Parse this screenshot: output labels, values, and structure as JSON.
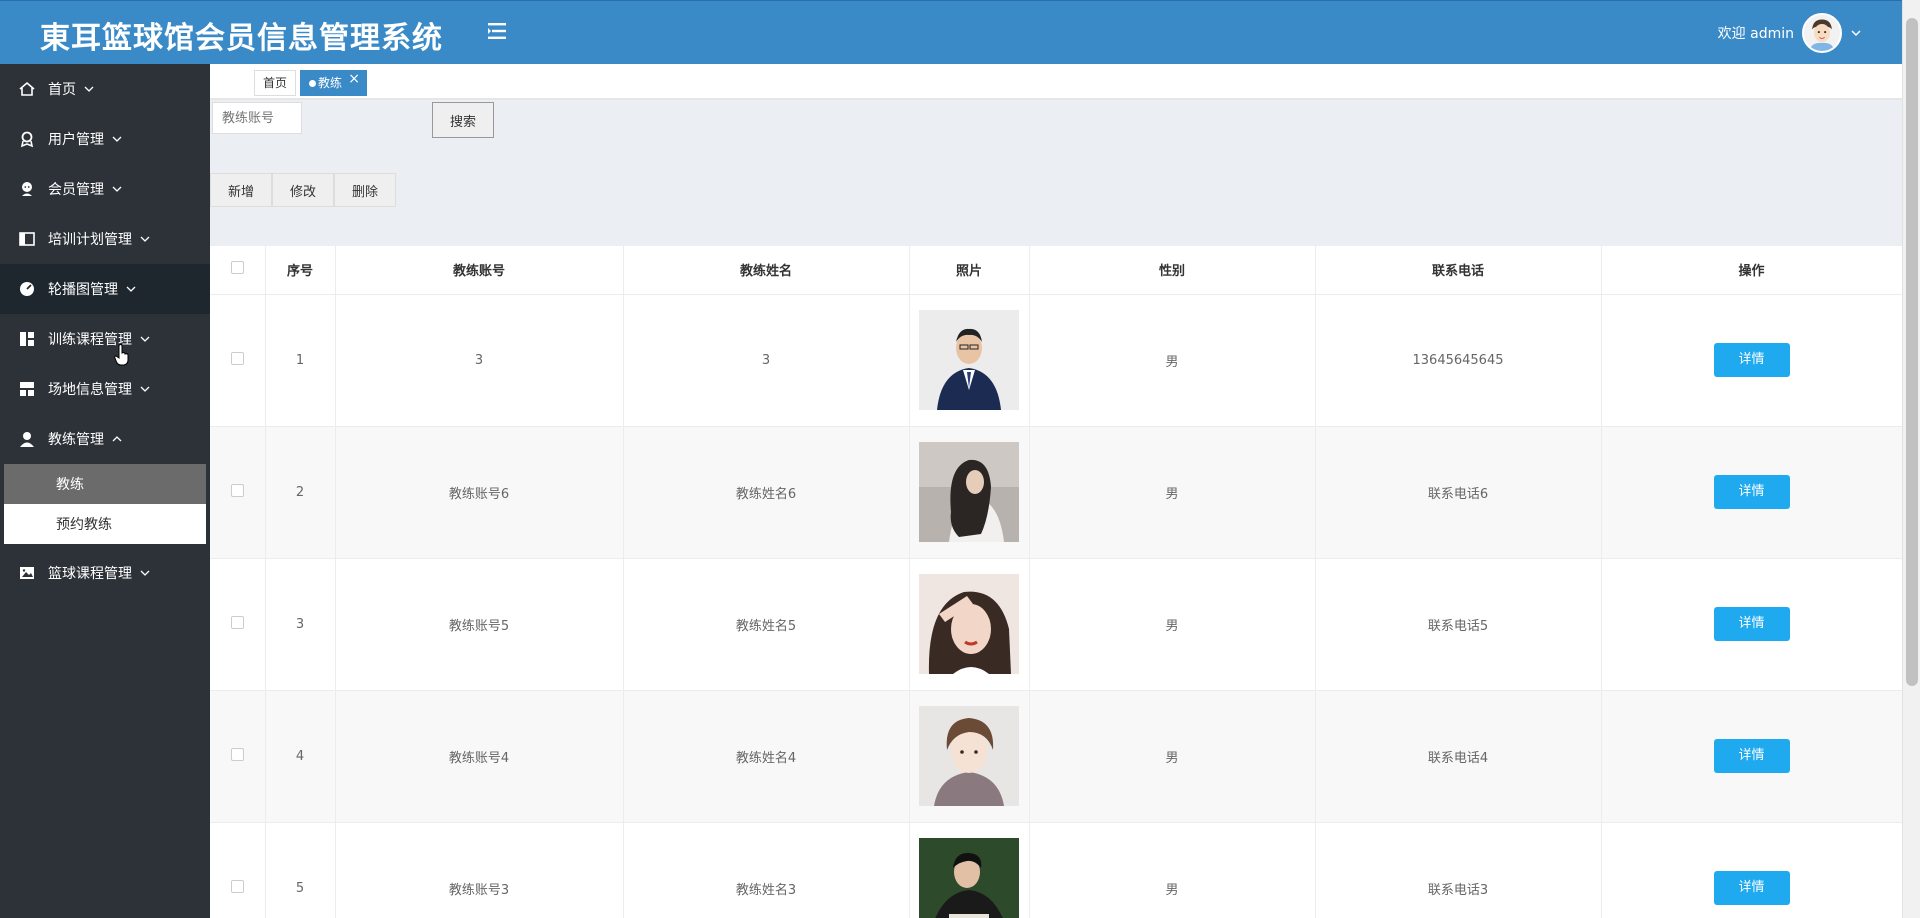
{
  "header": {
    "title": "東耳篮球馆会员信息管理系统",
    "welcome": "欢迎 admin"
  },
  "sidebar": {
    "items": [
      {
        "label": "首页",
        "icon": "home-icon",
        "expanded": false
      },
      {
        "label": "用户管理",
        "icon": "user-badge-icon",
        "expanded": false
      },
      {
        "label": "会员管理",
        "icon": "member-icon",
        "expanded": false
      },
      {
        "label": "培训计划管理",
        "icon": "panel-icon",
        "expanded": false
      },
      {
        "label": "轮播图管理",
        "icon": "gauge-icon",
        "expanded": false
      },
      {
        "label": "训练课程管理",
        "icon": "dashboard-icon",
        "expanded": false
      },
      {
        "label": "场地信息管理",
        "icon": "grid-icon",
        "expanded": false
      },
      {
        "label": "教练管理",
        "icon": "person-icon",
        "expanded": true
      },
      {
        "label": "篮球课程管理",
        "icon": "image-icon",
        "expanded": false
      }
    ],
    "submenu": [
      {
        "label": "教练",
        "active": true
      },
      {
        "label": "预约教练",
        "active": false
      }
    ]
  },
  "tabs": {
    "home": "首页",
    "active": "教练",
    "close": "×"
  },
  "search": {
    "placeholder": "教练账号",
    "button": "搜索"
  },
  "actions": {
    "add": "新增",
    "edit": "修改",
    "delete": "删除"
  },
  "table": {
    "headers": [
      "序号",
      "教练账号",
      "教练姓名",
      "照片",
      "性别",
      "联系电话",
      "操作"
    ],
    "rows": [
      {
        "index": "1",
        "account": "3",
        "name": "3",
        "gender": "男",
        "phone": "13645645645",
        "action": "详情",
        "photo": "man-in-suit"
      },
      {
        "index": "2",
        "account": "教练账号6",
        "name": "教练姓名6",
        "gender": "男",
        "phone": "联系电话6",
        "action": "详情",
        "photo": "woman-long-hair"
      },
      {
        "index": "3",
        "account": "教练账号5",
        "name": "教练姓名5",
        "gender": "男",
        "phone": "联系电话5",
        "action": "详情",
        "photo": "woman-salute"
      },
      {
        "index": "4",
        "account": "教练账号4",
        "name": "教练姓名4",
        "gender": "男",
        "phone": "联系电话4",
        "action": "详情",
        "photo": "young-man"
      },
      {
        "index": "5",
        "account": "教练账号3",
        "name": "教练姓名3",
        "gender": "男",
        "phone": "联系电话3",
        "action": "详情",
        "photo": "man-reading"
      }
    ]
  },
  "colors": {
    "header": "#3a8ac8",
    "sidebar": "#2c3238",
    "detail_button": "#1faaf0",
    "content_bg": "#ebeef3"
  }
}
